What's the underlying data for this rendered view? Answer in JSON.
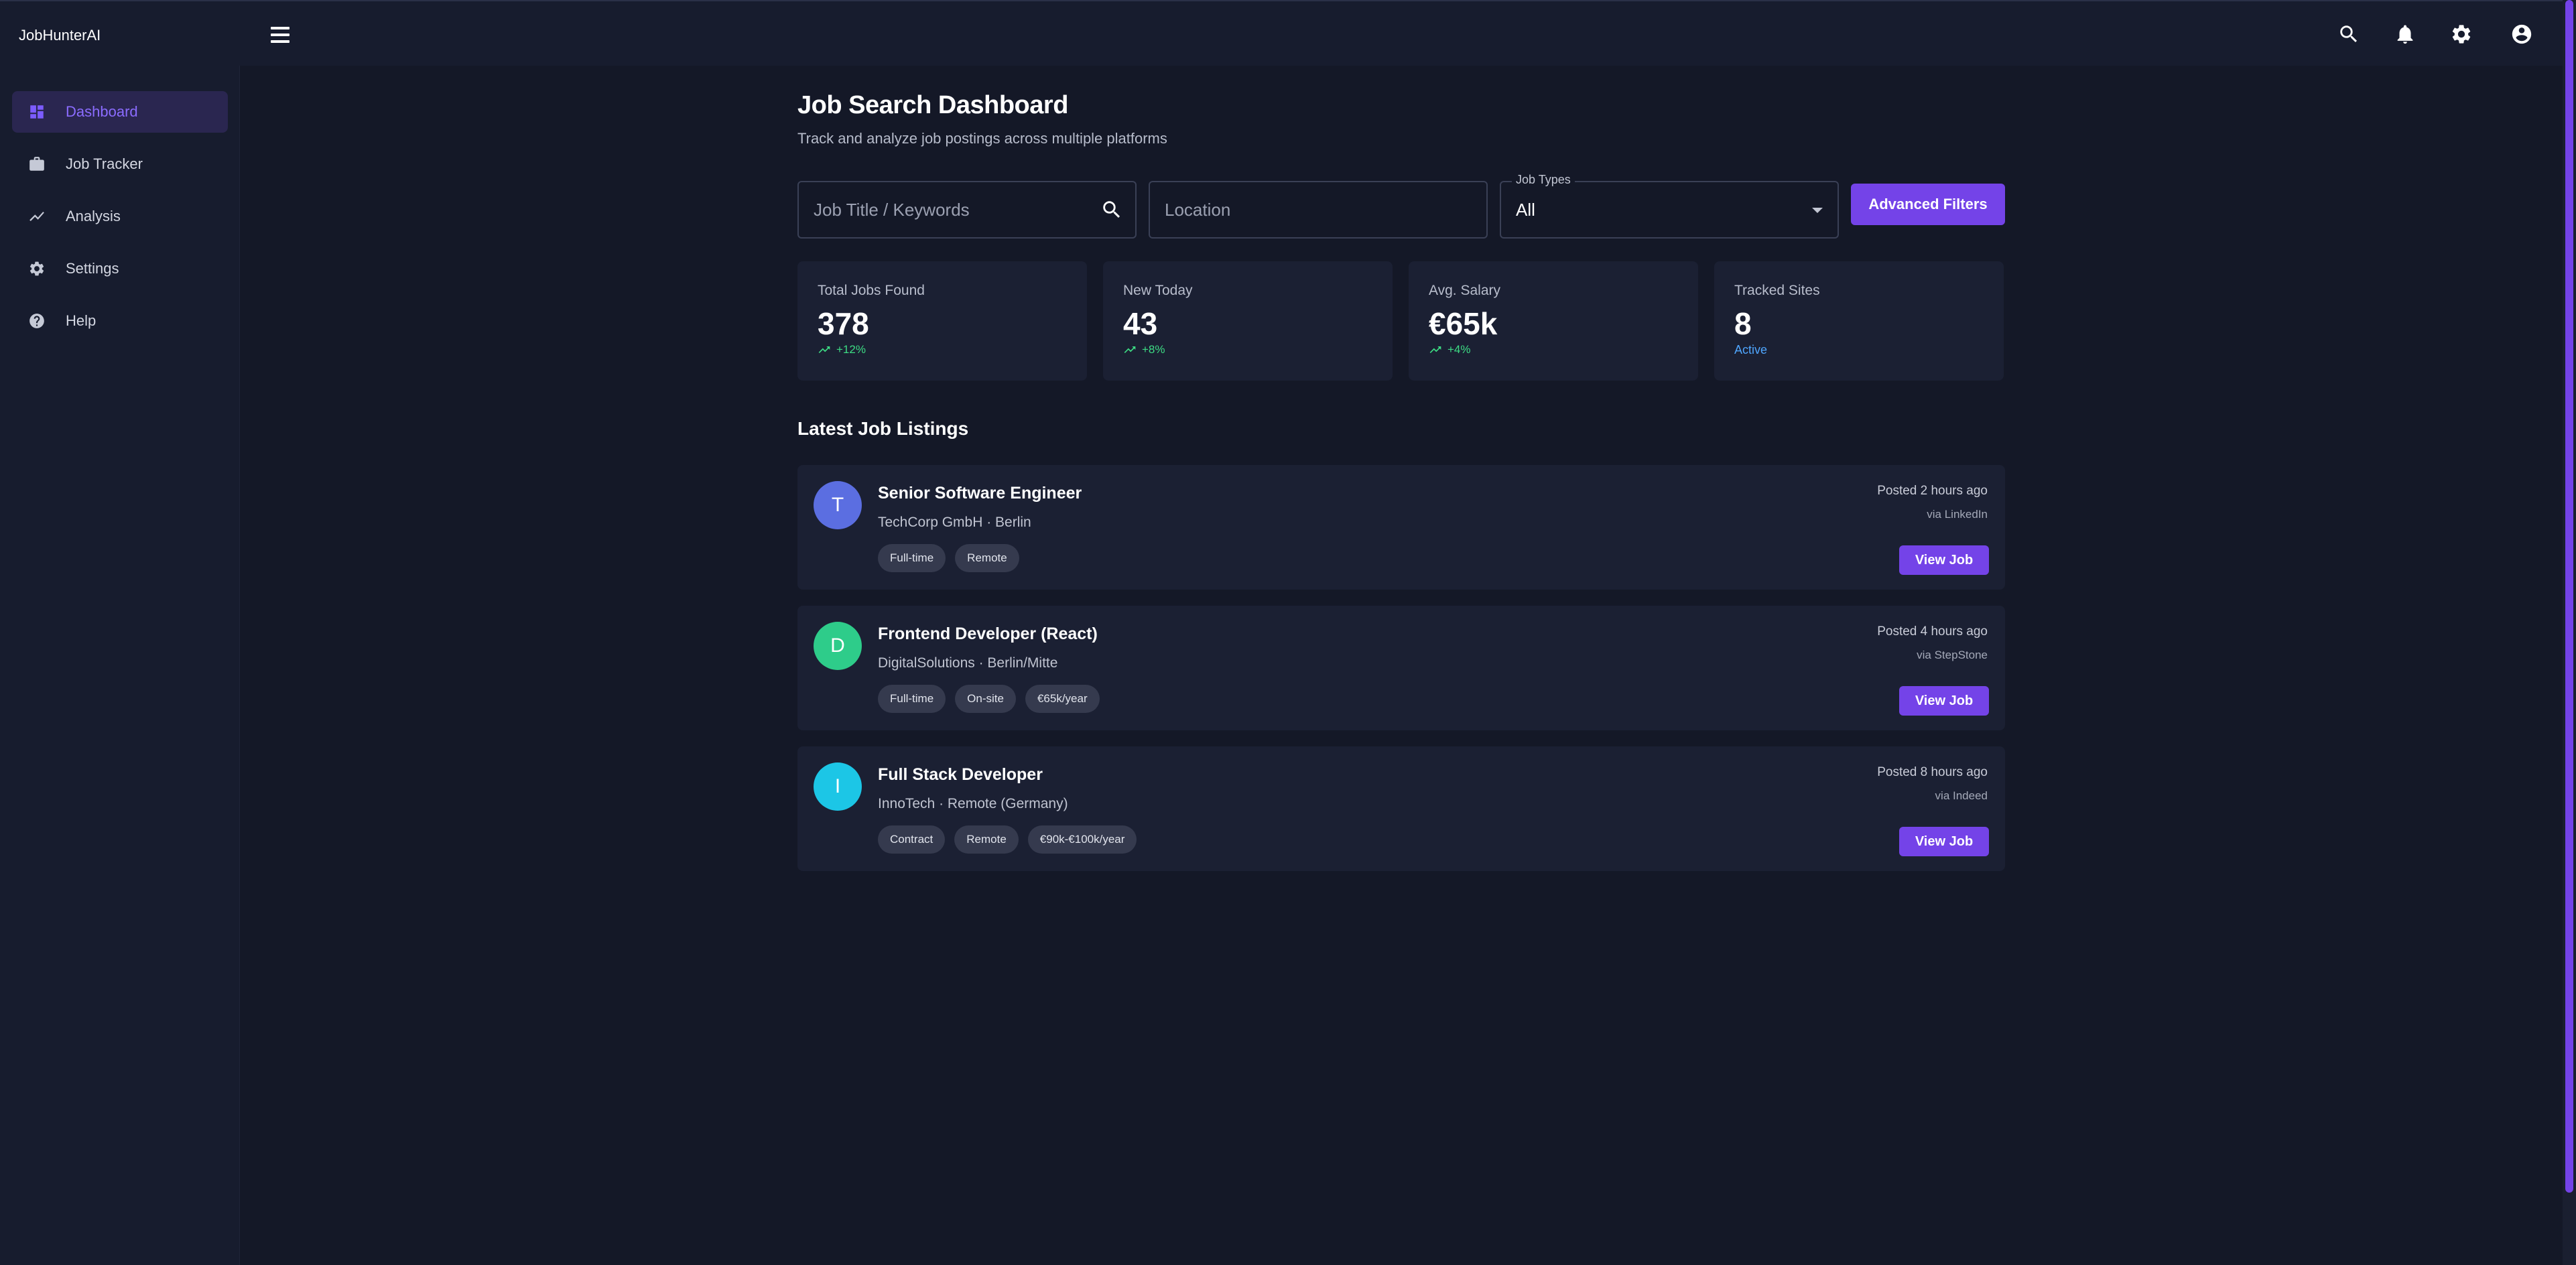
{
  "app": {
    "title": "JobHunterAI"
  },
  "topbar": {
    "icons": [
      "search-icon",
      "bell-icon",
      "gear-icon",
      "account-circle-icon"
    ]
  },
  "sidebar": {
    "items": [
      {
        "label": "Dashboard",
        "icon": "dashboard-icon",
        "active": true
      },
      {
        "label": "Job Tracker",
        "icon": "briefcase-icon",
        "active": false
      },
      {
        "label": "Analysis",
        "icon": "trending-up-icon",
        "active": false
      },
      {
        "label": "Settings",
        "icon": "gear-icon",
        "active": false
      },
      {
        "label": "Help",
        "icon": "help-circle-icon",
        "active": false
      }
    ]
  },
  "main": {
    "title": "Job Search Dashboard",
    "subtitle": "Track and analyze job postings across multiple platforms",
    "search": {
      "keywords_placeholder": "Job Title / Keywords",
      "keywords_value": "",
      "location_placeholder": "Location",
      "location_value": "",
      "job_types_label": "Job Types",
      "job_types_value": "All",
      "advanced_filters_label": "Advanced Filters"
    },
    "stats": [
      {
        "label": "Total Jobs Found",
        "value": "378",
        "trend": "+12%"
      },
      {
        "label": "New Today",
        "value": "43",
        "trend": "+8%"
      },
      {
        "label": "Avg. Salary",
        "value": "€65k",
        "trend": "+4%"
      },
      {
        "label": "Tracked Sites",
        "value": "8",
        "status": "Active"
      }
    ],
    "listings_title": "Latest Job Listings",
    "listings": [
      {
        "initial": "T",
        "avatar_color": "#5b6ee1",
        "title": "Senior Software Engineer",
        "company": "TechCorp GmbH · Berlin",
        "tags": [
          "Full-time",
          "Remote"
        ],
        "posted": "Posted 2 hours ago",
        "source": "via LinkedIn",
        "action": "View Job"
      },
      {
        "initial": "D",
        "avatar_color": "#2ecc8a",
        "title": "Frontend Developer (React)",
        "company": "DigitalSolutions · Berlin/Mitte",
        "tags": [
          "Full-time",
          "On-site",
          "€65k/year"
        ],
        "posted": "Posted 4 hours ago",
        "source": "via StepStone",
        "action": "View Job"
      },
      {
        "initial": "I",
        "avatar_color": "#1cc6e6",
        "title": "Full Stack Developer",
        "company": "InnoTech · Remote (Germany)",
        "tags": [
          "Contract",
          "Remote",
          "€90k-€100k/year"
        ],
        "posted": "Posted 8 hours ago",
        "source": "via Indeed",
        "action": "View Job"
      }
    ]
  },
  "colors": {
    "accent": "#7443e8",
    "background": "#141827",
    "panel": "#1b2033",
    "trend_up": "#3ddc84",
    "status_active": "#4fa6ff"
  }
}
